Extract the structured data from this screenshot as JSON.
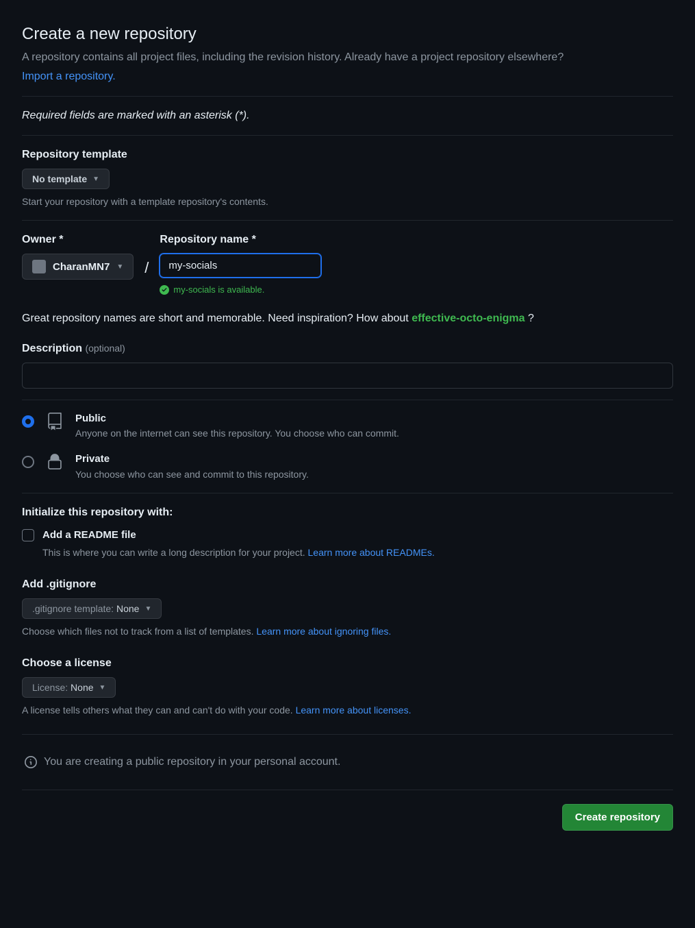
{
  "header": {
    "title": "Create a new repository",
    "subtitle": "A repository contains all project files, including the revision history. Already have a project repository elsewhere?",
    "import_link": "Import a repository."
  },
  "required_note": "Required fields are marked with an asterisk (*).",
  "template": {
    "label": "Repository template",
    "button": "No template",
    "help": "Start your repository with a template repository's contents."
  },
  "owner": {
    "label": "Owner *",
    "name": "CharanMN7"
  },
  "reponame": {
    "label": "Repository name *",
    "value": "my-socials",
    "available": "my-socials is available."
  },
  "inspiration": {
    "prefix": "Great repository names are short and memorable. Need inspiration? How about ",
    "suggestion": "effective-octo-enigma",
    "suffix": " ?"
  },
  "description": {
    "label": "Description",
    "optional": "(optional)"
  },
  "visibility": {
    "public": {
      "title": "Public",
      "desc": "Anyone on the internet can see this repository. You choose who can commit."
    },
    "private": {
      "title": "Private",
      "desc": "You choose who can see and commit to this repository."
    }
  },
  "init": {
    "heading": "Initialize this repository with:",
    "readme": {
      "label": "Add a README file",
      "desc": "This is where you can write a long description for your project. ",
      "link": "Learn more about READMEs."
    }
  },
  "gitignore": {
    "label": "Add .gitignore",
    "button_prefix": ".gitignore template: ",
    "button_value": "None",
    "help": "Choose which files not to track from a list of templates. ",
    "link": "Learn more about ignoring files."
  },
  "license": {
    "label": "Choose a license",
    "button_prefix": "License: ",
    "button_value": "None",
    "help": "A license tells others what they can and can't do with your code. ",
    "link": "Learn more about licenses."
  },
  "info": "You are creating a public repository in your personal account.",
  "submit": "Create repository"
}
